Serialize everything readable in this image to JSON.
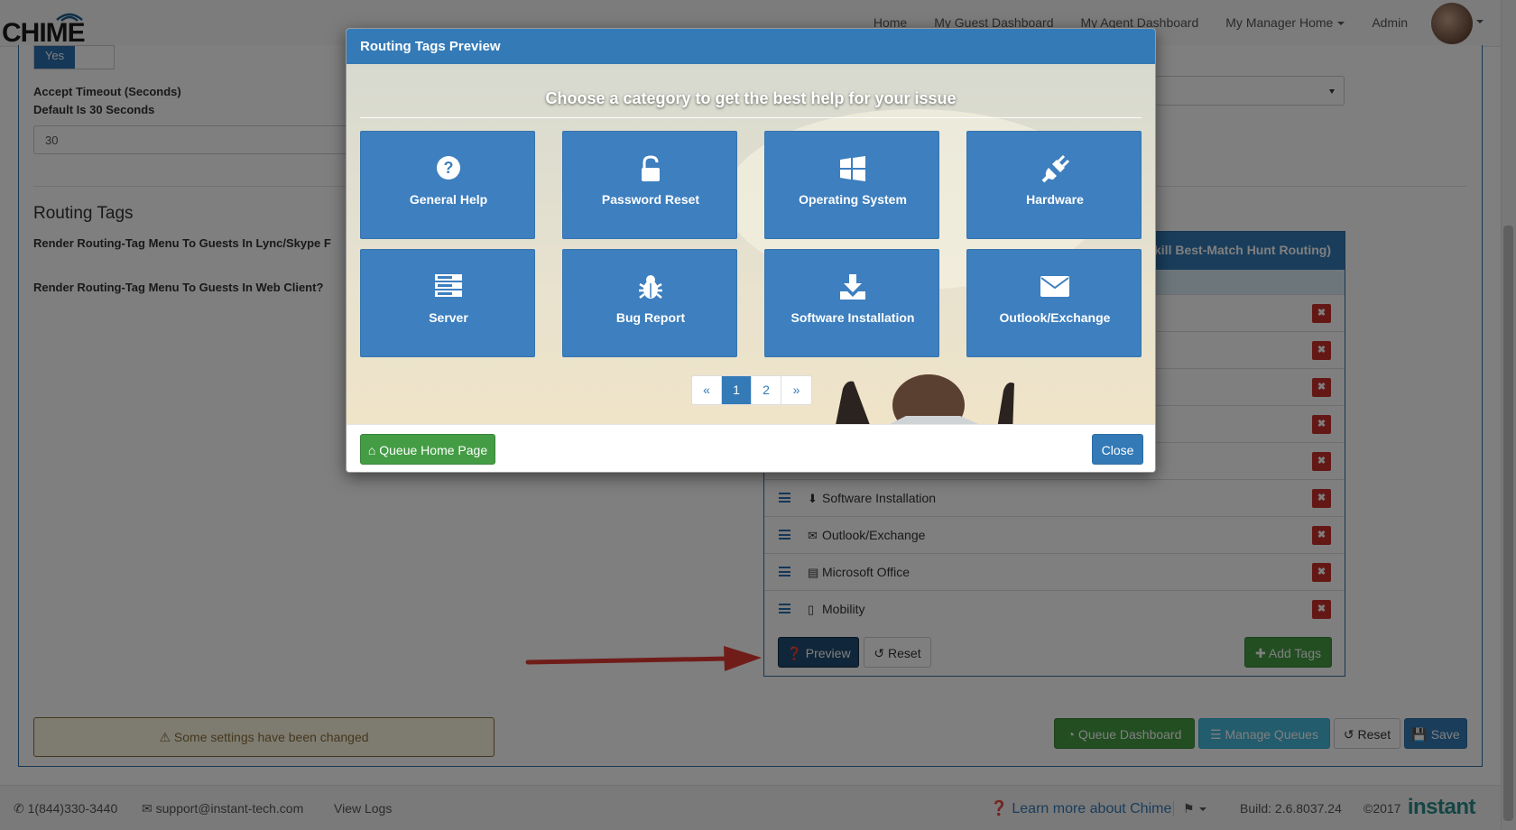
{
  "navbar": {
    "logo": "CHIME",
    "links": [
      "Home",
      "My Guest Dashboard",
      "My Agent Dashboard",
      "My Manager Home",
      "Admin"
    ]
  },
  "settings": {
    "toggle_yes": "Yes",
    "accept_timeout_label": "Accept Timeout (Seconds)",
    "accept_timeout_sub": "Default Is 30 Seconds",
    "accept_timeout_value": "30",
    "routing_tags_title": "Routing Tags",
    "render_lync_label": "Render Routing-Tag Menu To Guests In Lync/Skype F",
    "render_web_label": "Render Routing-Tag Menu To Guests In Web Client?"
  },
  "tags_panel": {
    "header": "kill Best-Match Hunt Routing)",
    "rows": [
      {
        "icon": "",
        "label": ""
      },
      {
        "icon": "",
        "label": ""
      },
      {
        "icon": "",
        "label": ""
      },
      {
        "icon": "",
        "label": ""
      },
      {
        "icon": "",
        "label": ""
      },
      {
        "icon": "download-icon",
        "label": "Software Installation"
      },
      {
        "icon": "envelope-icon",
        "label": "Outlook/Exchange"
      },
      {
        "icon": "word-file-icon",
        "label": "Microsoft Office"
      },
      {
        "icon": "mobile-icon",
        "label": "Mobility"
      }
    ],
    "preview_btn": "Preview",
    "reset_btn": "Reset",
    "add_tags_btn": "Add Tags"
  },
  "bottom_bar": {
    "warning": "Some settings have been changed",
    "queue_dashboard": "Queue Dashboard",
    "manage_queues": "Manage Queues",
    "reset": "Reset",
    "save": "Save"
  },
  "footer": {
    "phone": "1(844)330-3440",
    "email": "support@instant-tech.com",
    "view_logs": "View Logs",
    "learn_more": "Learn more about Chime",
    "build": "Build: 2.6.8037.24",
    "copyright": "©2017",
    "brand": "instant"
  },
  "modal": {
    "title": "Routing Tags Preview",
    "tagline": "Choose a category to get the best help for your issue",
    "tiles": [
      {
        "label": "General Help",
        "icon": "question-circle-icon"
      },
      {
        "label": "Password Reset",
        "icon": "unlock-icon"
      },
      {
        "label": "Operating System",
        "icon": "windows-icon"
      },
      {
        "label": "Hardware",
        "icon": "plug-icon"
      },
      {
        "label": "Server",
        "icon": "server-icon"
      },
      {
        "label": "Bug Report",
        "icon": "bug-icon"
      },
      {
        "label": "Software Installation",
        "icon": "download-icon"
      },
      {
        "label": "Outlook/Exchange",
        "icon": "envelope-icon"
      }
    ],
    "pager": {
      "prev": "«",
      "pages": [
        "1",
        "2"
      ],
      "next": "»",
      "active_page": "1"
    },
    "queue_home_btn": "Queue Home Page",
    "close_btn": "Close"
  },
  "colors": {
    "primary": "#337ab7",
    "success": "#449d44",
    "danger": "#c9302c",
    "info": "#46b8da"
  }
}
